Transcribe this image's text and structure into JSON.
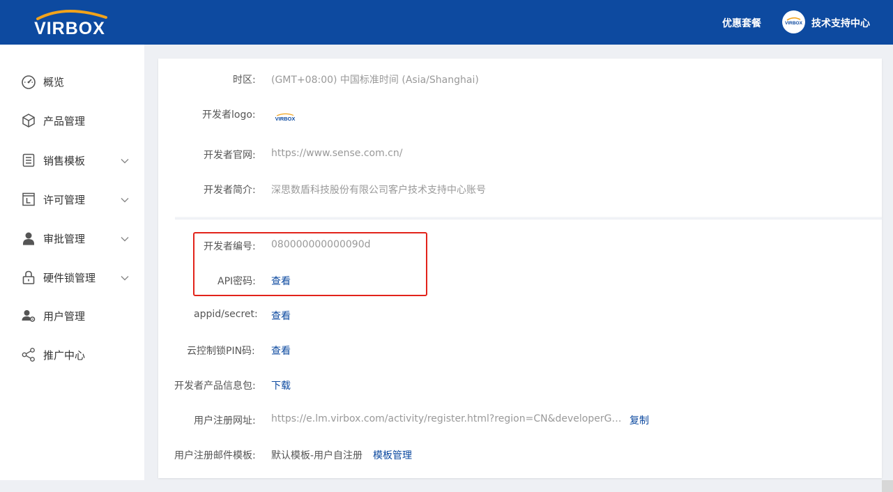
{
  "header": {
    "logo_text": "VIRBOX",
    "offers_label": "优惠套餐",
    "account_label": "技术支持中心",
    "avatar_text": "VIRBOX"
  },
  "sidebar": {
    "items": [
      {
        "label": "概览",
        "icon": "dashboard-icon",
        "expandable": false
      },
      {
        "label": "产品管理",
        "icon": "cube-icon",
        "expandable": false
      },
      {
        "label": "销售模板",
        "icon": "list-icon",
        "expandable": true
      },
      {
        "label": "许可管理",
        "icon": "license-icon",
        "expandable": true
      },
      {
        "label": "审批管理",
        "icon": "user-icon",
        "expandable": true
      },
      {
        "label": "硬件锁管理",
        "icon": "lock-icon",
        "expandable": true
      },
      {
        "label": "用户管理",
        "icon": "users-gear-icon",
        "expandable": false
      },
      {
        "label": "推广中心",
        "icon": "share-icon",
        "expandable": false
      }
    ]
  },
  "profile": {
    "timezone_label": "时区:",
    "timezone_value": "(GMT+08:00) 中国标准时间 (Asia/Shanghai)",
    "logo_label": "开发者logo:",
    "logo_text": "VIRBOX",
    "website_label": "开发者官网:",
    "website_value": "https://www.sense.com.cn/",
    "intro_label": "开发者简介:",
    "intro_value": "深思数盾科技股份有限公司客户技术支持中心账号"
  },
  "credentials": {
    "dev_id_label": "开发者编号:",
    "dev_id_value": "080000000000090d",
    "api_key_label": "API密码:",
    "api_key_action": "查看",
    "appid_label": "appid/secret:",
    "appid_action": "查看",
    "pin_label": "云控制锁PIN码:",
    "pin_action": "查看",
    "package_label": "开发者产品信息包:",
    "package_action": "下载",
    "register_url_label": "用户注册网址:",
    "register_url_value": "https://e.lm.virbox.com/activity/register.html?region=CN&developerGuid...",
    "register_url_action": "复制",
    "email_tpl_label": "用户注册邮件模板:",
    "email_tpl_value": "默认模板-用户自注册",
    "email_tpl_action": "模板管理"
  },
  "colors": {
    "brand_blue": "#0d4aa0",
    "logo_arc": "#f2a31b",
    "highlight_red": "#e2231a"
  }
}
